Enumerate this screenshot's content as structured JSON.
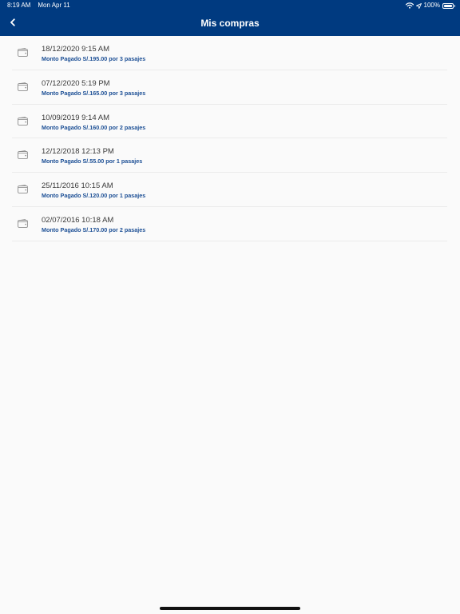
{
  "status_bar": {
    "time": "8:19 AM",
    "date": "Mon Apr 11",
    "battery_text": "100%",
    "battery_level": 1.0
  },
  "nav": {
    "title": "Mis compras",
    "back_icon": "chevron-left-icon"
  },
  "purchases": [
    {
      "date": "18/12/2020 9:15 AM",
      "amount": "Monto Pagado S/.195.00 por 3 pasajes"
    },
    {
      "date": "07/12/2020 5:19 PM",
      "amount": "Monto Pagado S/.165.00 por 3 pasajes"
    },
    {
      "date": "10/09/2019 9:14 AM",
      "amount": "Monto Pagado S/.160.00 por 2 pasajes"
    },
    {
      "date": "12/12/2018 12:13 PM",
      "amount": "Monto Pagado S/.55.00 por 1 pasajes"
    },
    {
      "date": "25/11/2016 10:15 AM",
      "amount": "Monto Pagado S/.120.00 por 1 pasajes"
    },
    {
      "date": "02/07/2016 10:18 AM",
      "amount": "Monto Pagado S/.170.00 por 2 pasajes"
    }
  ],
  "colors": {
    "header_bg": "#003a80",
    "accent_text": "#1c4f95",
    "page_bg": "#fafafa"
  }
}
